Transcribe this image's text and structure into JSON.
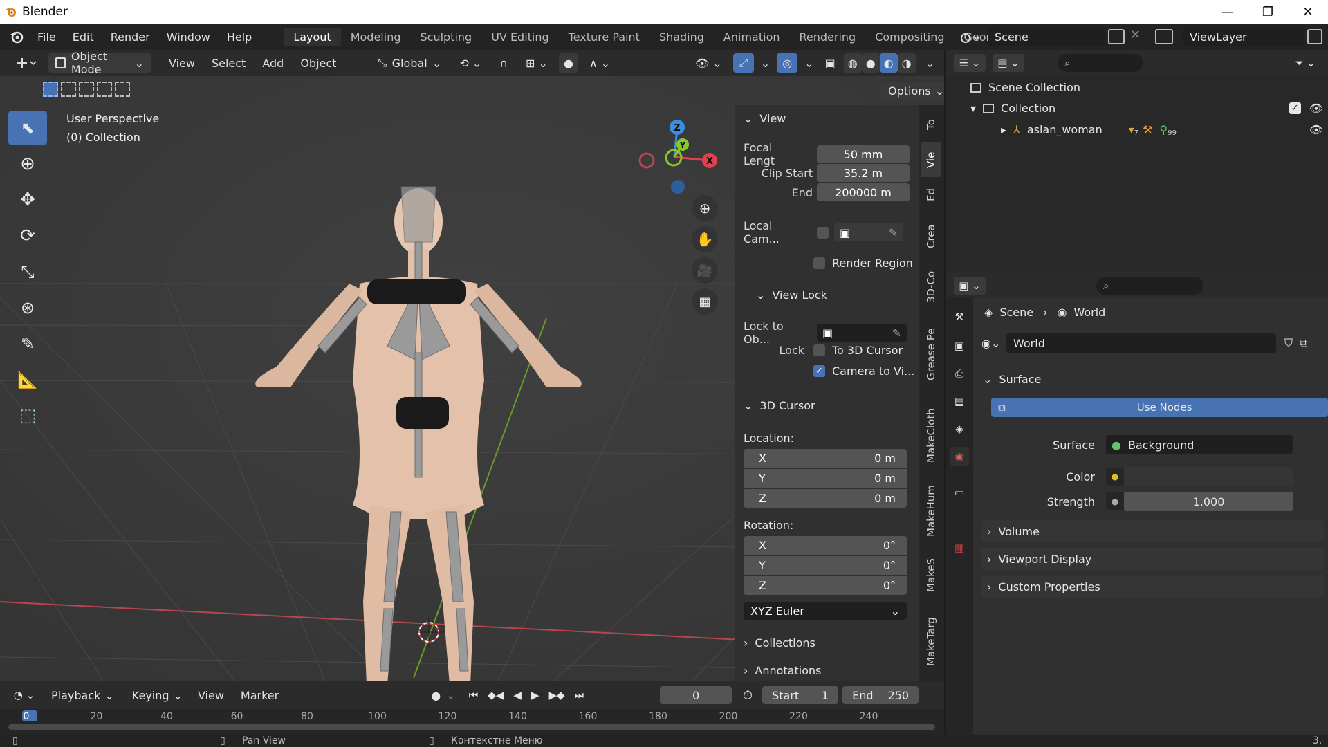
{
  "titlebar": {
    "title": "Blender",
    "min": "—",
    "max": "❐",
    "close": "✕"
  },
  "menubar": {
    "menus": [
      "File",
      "Edit",
      "Render",
      "Window",
      "Help"
    ],
    "workspaces": [
      "Layout",
      "Modeling",
      "Sculpting",
      "UV Editing",
      "Texture Paint",
      "Shading",
      "Animation",
      "Rendering",
      "Compositing",
      "Geometry Nod"
    ],
    "active_workspace": "Layout",
    "scene": "Scene",
    "view_layer": "ViewLayer"
  },
  "viewport_header": {
    "mode": "Object Mode",
    "menus": [
      "View",
      "Select",
      "Add",
      "Object"
    ],
    "transform_orientation": "Global",
    "options": "Options"
  },
  "viewport": {
    "view_name": "User Perspective",
    "collection_label": "(0) Collection",
    "gizmo": {
      "z": "Z",
      "y": "Y",
      "x": "X"
    }
  },
  "npanel": {
    "view_section": "View",
    "focal_length_label": "Focal Lengt",
    "focal_length_value": "50 mm",
    "clip_start_label": "Clip Start",
    "clip_start_value": "35.2 m",
    "clip_end_label": "End",
    "clip_end_value": "200000 m",
    "local_camera_label": "Local Cam...",
    "render_region_label": "Render Region",
    "view_lock_section": "View Lock",
    "lock_to_object_label": "Lock to Ob...",
    "lock_label": "Lock",
    "to_3d_cursor_label": "To 3D Cursor",
    "camera_to_view_label": "Camera to Vi...",
    "cursor_section": "3D Cursor",
    "location_label": "Location:",
    "loc_x_label": "X",
    "loc_x_value": "0 m",
    "loc_y_label": "Y",
    "loc_y_value": "0 m",
    "loc_z_label": "Z",
    "loc_z_value": "0 m",
    "rotation_label": "Rotation:",
    "rot_x_label": "X",
    "rot_x_value": "0°",
    "rot_y_label": "Y",
    "rot_y_value": "0°",
    "rot_z_label": "Z",
    "rot_z_value": "0°",
    "rotation_mode": "XYZ Euler",
    "collections_section": "Collections",
    "annotations_section": "Annotations",
    "tabs": [
      "To",
      "Vie",
      "Ed",
      "Crea",
      "3D-Co",
      "Grease Pe",
      "MakeCloth",
      "MakeHum",
      "MakeS",
      "MakeTarg"
    ]
  },
  "outliner": {
    "scene_collection": "Scene Collection",
    "collection": "Collection",
    "object": "asian_woman",
    "modifier_count": "7",
    "bone_count": "99"
  },
  "properties": {
    "breadcrumb_scene": "Scene",
    "breadcrumb_world": "World",
    "world_name": "World",
    "surface_section": "Surface",
    "use_nodes": "Use Nodes",
    "surface_label": "Surface",
    "surface_value": "Background",
    "color_label": "Color",
    "strength_label": "Strength",
    "strength_value": "1.000",
    "volume_section": "Volume",
    "viewport_display_section": "Viewport Display",
    "custom_properties_section": "Custom Properties"
  },
  "timeline": {
    "menus": [
      "Playback",
      "Keying",
      "View",
      "Marker"
    ],
    "current_frame": "0",
    "start_label": "Start",
    "start_value": "1",
    "end_label": "End",
    "end_value": "250",
    "ruler": [
      "0",
      "20",
      "40",
      "60",
      "80",
      "100",
      "120",
      "140",
      "160",
      "180",
      "200",
      "220",
      "240"
    ]
  },
  "statusbar": {
    "pan_view": "Pan View",
    "context_menu": "Контекстне Меню",
    "version_fragment": "3."
  },
  "colors": {
    "accent": "#4772b3",
    "viewport_bg": "#3c3c3c",
    "panel_bg": "#303030",
    "x_axis": "#e0414f",
    "y_axis": "#87c72e",
    "z_axis": "#3d8ee0"
  }
}
